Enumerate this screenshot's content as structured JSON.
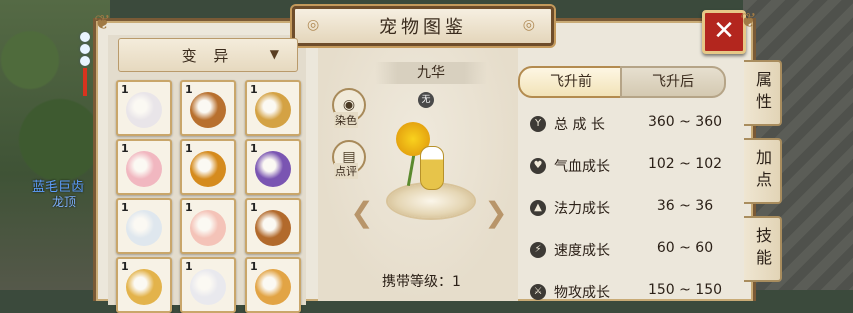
{
  "window": {
    "title": "宠物图鉴"
  },
  "scene": {
    "npc_name": "蓝毛巨齿",
    "npc_sub": "龙顶"
  },
  "filter": {
    "selected": "变 异"
  },
  "pets": [
    {
      "level": "1",
      "color": "#e9e5e9"
    },
    {
      "level": "1",
      "color": "#b8702e"
    },
    {
      "level": "1",
      "color": "#d4a244"
    },
    {
      "level": "1",
      "color": "#f1b7c0"
    },
    {
      "level": "1",
      "color": "#d58b1e"
    },
    {
      "level": "1",
      "color": "#7a55b2"
    },
    {
      "level": "1",
      "color": "#dfe7ee"
    },
    {
      "level": "1",
      "color": "#f4c3b8"
    },
    {
      "level": "1",
      "color": "#b26a2c"
    },
    {
      "level": "1",
      "color": "#e3b34b"
    },
    {
      "level": "1",
      "color": "#e9e9ee"
    },
    {
      "level": "1",
      "color": "#e2a445"
    }
  ],
  "pet_detail": {
    "name": "九华",
    "element": "无",
    "dye_label": "染色",
    "comment_label": "点评",
    "carry_level_label": "携带等级：1"
  },
  "tabs": {
    "before": "飞升前",
    "after": "飞升后"
  },
  "stats": [
    {
      "icon": "Y",
      "label": "总 成 长",
      "value": "360 ~ 360"
    },
    {
      "icon": "♥",
      "label": "气血成长",
      "value": "102 ~ 102"
    },
    {
      "icon": "▲",
      "label": "法力成长",
      "value": "36 ~ 36"
    },
    {
      "icon": "⚡",
      "label": "速度成长",
      "value": "60 ~ 60"
    },
    {
      "icon": "⚔",
      "label": "物攻成长",
      "value": "150 ~ 150"
    }
  ],
  "side_tabs": [
    "属性",
    "加点",
    "技能"
  ],
  "close_label": "✕"
}
